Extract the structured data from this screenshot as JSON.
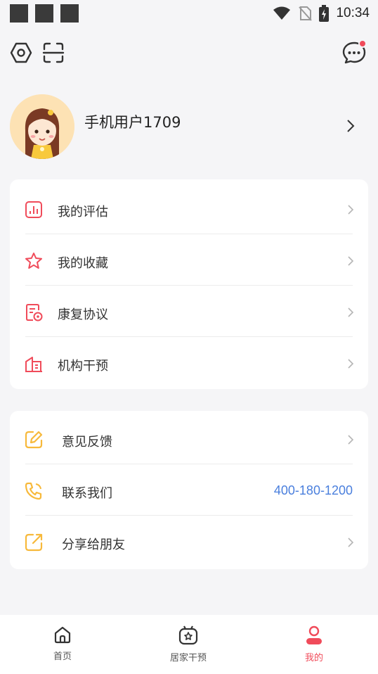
{
  "status_bar": {
    "time": "10:34"
  },
  "profile": {
    "username": "手机用户1709"
  },
  "menu_group_1": [
    {
      "label": "我的评估",
      "icon": "assessment-chart-icon"
    },
    {
      "label": "我的收藏",
      "icon": "star-icon"
    },
    {
      "label": "康复协议",
      "icon": "document-badge-icon"
    },
    {
      "label": "机构干预",
      "icon": "building-icon"
    }
  ],
  "menu_group_2": [
    {
      "label": "意见反馈",
      "icon": "edit-feedback-icon"
    },
    {
      "label": "联系我们",
      "icon": "phone-icon",
      "value": "400-180-1200"
    },
    {
      "label": "分享给朋友",
      "icon": "share-icon"
    }
  ],
  "bottom_nav": [
    {
      "label": "首页",
      "icon": "home-icon"
    },
    {
      "label": "居家干预",
      "icon": "home-care-icon"
    },
    {
      "label": "我的",
      "icon": "user-icon",
      "active": true
    }
  ],
  "colors": {
    "accent_red": "#f04b5a",
    "icon_yellow": "#f7b93b",
    "link_blue": "#4a7fdd"
  }
}
